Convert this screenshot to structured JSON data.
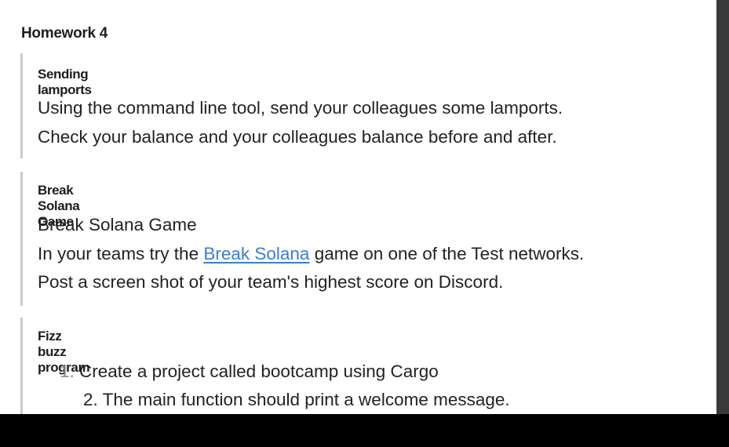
{
  "page": {
    "title": "Homework 4"
  },
  "sections": [
    {
      "heading": "Sending lamports",
      "lines": [
        "Using the command line tool, send your colleagues some lamports.",
        "Check your balance and your colleagues balance before and after."
      ]
    },
    {
      "heading": "Break Solana Game",
      "line1": "Break Solana Game",
      "line2_before": "In your teams try the ",
      "line2_link": "Break Solana",
      "line2_after": " game on one of the Test networks.",
      "line3": "Post a screen shot of your team's highest score on Discord."
    },
    {
      "heading": "Fizz buzz program",
      "items": [
        {
          "num": "1.",
          "text": "Create a project called bootcamp using Cargo"
        },
        {
          "num": "2.",
          "text": "The main function should print a welcome message."
        }
      ]
    }
  ]
}
